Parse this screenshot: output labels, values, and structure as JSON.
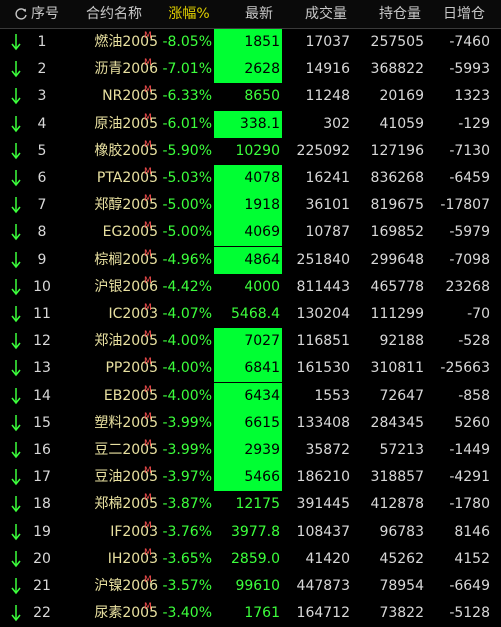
{
  "header": {
    "columns": [
      "序号",
      "合约名称",
      "涨幅%",
      "最新",
      "成交量",
      "持仓量",
      "日增仓"
    ],
    "sort_column_index": 2
  },
  "market_suffix": "M",
  "colors": {
    "down": "#3cff3c",
    "highlight_bg": "#00ff33",
    "sort_header": "#e0d000",
    "name": "#e8e0a0"
  },
  "rows": [
    {
      "idx": "1",
      "name": "燃油2005",
      "chg": "-8.05%",
      "last": "1851",
      "vol": "17037",
      "oi": "257505",
      "dd": "-7460",
      "hl": true
    },
    {
      "idx": "2",
      "name": "沥青2006",
      "chg": "-7.01%",
      "last": "2628",
      "vol": "14916",
      "oi": "368822",
      "dd": "-5993",
      "hl": true
    },
    {
      "idx": "3",
      "name": "NR2005",
      "chg": "-6.33%",
      "last": "8650",
      "vol": "11248",
      "oi": "20169",
      "dd": "1323",
      "hl": false
    },
    {
      "idx": "4",
      "name": "原油2005",
      "chg": "-6.01%",
      "last": "338.1",
      "vol": "302",
      "oi": "41059",
      "dd": "-129",
      "hl": true
    },
    {
      "idx": "5",
      "name": "橡胶2005",
      "chg": "-5.90%",
      "last": "10290",
      "vol": "225092",
      "oi": "127196",
      "dd": "-7130",
      "hl": false
    },
    {
      "idx": "6",
      "name": "PTA2005",
      "chg": "-5.03%",
      "last": "4078",
      "vol": "16241",
      "oi": "836268",
      "dd": "-6459",
      "hl": true
    },
    {
      "idx": "7",
      "name": "郑醇2005",
      "chg": "-5.00%",
      "last": "1918",
      "vol": "36101",
      "oi": "819675",
      "dd": "-17807",
      "hl": true
    },
    {
      "idx": "8",
      "name": "EG2005",
      "chg": "-5.00%",
      "last": "4069",
      "vol": "10787",
      "oi": "169852",
      "dd": "-5979",
      "hl": true
    },
    {
      "idx": "9",
      "name": "棕榈2005",
      "chg": "-4.96%",
      "last": "4864",
      "vol": "251840",
      "oi": "299648",
      "dd": "-7098",
      "hl": true
    },
    {
      "idx": "10",
      "name": "沪银2006",
      "chg": "-4.42%",
      "last": "4000",
      "vol": "811443",
      "oi": "465778",
      "dd": "23268",
      "hl": false
    },
    {
      "idx": "11",
      "name": "IC2003",
      "chg": "-4.07%",
      "last": "5468.4",
      "vol": "130204",
      "oi": "111299",
      "dd": "-70",
      "hl": false
    },
    {
      "idx": "12",
      "name": "郑油2005",
      "chg": "-4.00%",
      "last": "7027",
      "vol": "116851",
      "oi": "92188",
      "dd": "-528",
      "hl": true
    },
    {
      "idx": "13",
      "name": "PP2005",
      "chg": "-4.00%",
      "last": "6841",
      "vol": "161530",
      "oi": "310811",
      "dd": "-25663",
      "hl": true
    },
    {
      "idx": "14",
      "name": "EB2005",
      "chg": "-4.00%",
      "last": "6434",
      "vol": "1553",
      "oi": "72647",
      "dd": "-858",
      "hl": true
    },
    {
      "idx": "15",
      "name": "塑料2005",
      "chg": "-3.99%",
      "last": "6615",
      "vol": "133408",
      "oi": "284345",
      "dd": "5260",
      "hl": true
    },
    {
      "idx": "16",
      "name": "豆二2005",
      "chg": "-3.99%",
      "last": "2939",
      "vol": "35872",
      "oi": "57213",
      "dd": "-1449",
      "hl": true
    },
    {
      "idx": "17",
      "name": "豆油2005",
      "chg": "-3.97%",
      "last": "5466",
      "vol": "186210",
      "oi": "318857",
      "dd": "-4291",
      "hl": true
    },
    {
      "idx": "18",
      "name": "郑棉2005",
      "chg": "-3.87%",
      "last": "12175",
      "vol": "391445",
      "oi": "412878",
      "dd": "-1780",
      "hl": false
    },
    {
      "idx": "19",
      "name": "IF2003",
      "chg": "-3.76%",
      "last": "3977.8",
      "vol": "108437",
      "oi": "96783",
      "dd": "8146",
      "hl": false
    },
    {
      "idx": "20",
      "name": "IH2003",
      "chg": "-3.65%",
      "last": "2859.0",
      "vol": "41420",
      "oi": "45262",
      "dd": "4152",
      "hl": false
    },
    {
      "idx": "21",
      "name": "沪镍2006",
      "chg": "-3.57%",
      "last": "99610",
      "vol": "447873",
      "oi": "78954",
      "dd": "-6649",
      "hl": false
    },
    {
      "idx": "22",
      "name": "尿素2005",
      "chg": "-3.40%",
      "last": "1761",
      "vol": "164712",
      "oi": "73822",
      "dd": "-5128",
      "hl": false
    }
  ]
}
